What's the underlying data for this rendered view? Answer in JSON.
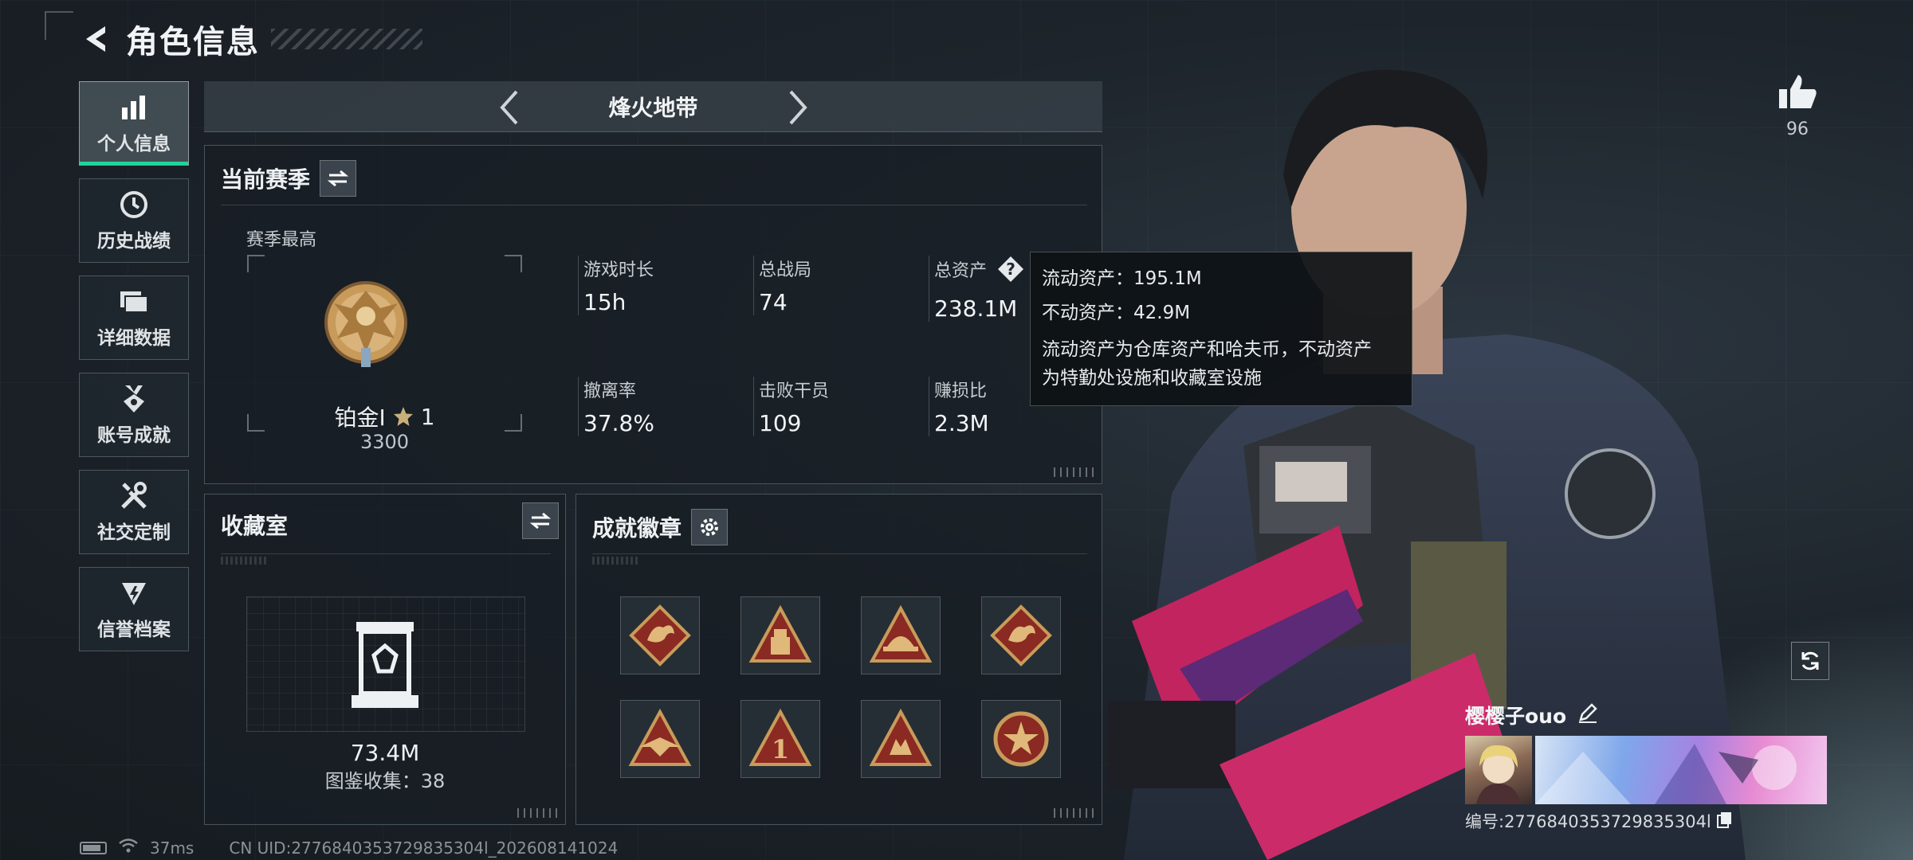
{
  "header": {
    "title": "角色信息"
  },
  "sidebar": {
    "items": [
      {
        "label": "个人信息",
        "icon": "bar-chart-icon",
        "active": true
      },
      {
        "label": "历史战绩",
        "icon": "clock-icon",
        "active": false
      },
      {
        "label": "详细数据",
        "icon": "folder-icon",
        "active": false
      },
      {
        "label": "账号成就",
        "icon": "medal-icon",
        "active": false
      },
      {
        "label": "社交定制",
        "icon": "wrench-icon",
        "active": false
      },
      {
        "label": "信誉档案",
        "icon": "shield-icon",
        "active": false
      }
    ]
  },
  "mode": {
    "title": "烽火地带"
  },
  "season": {
    "title": "当前赛季",
    "best_label": "赛季最高",
    "rank": {
      "name": "铂金Ⅰ",
      "stars": "1",
      "score": "3300"
    },
    "stats": [
      {
        "label": "游戏时长",
        "value": "15h"
      },
      {
        "label": "总战局",
        "value": "74"
      },
      {
        "label": "总资产",
        "value": "238.1M"
      },
      {
        "label": "撤离率",
        "value": "37.8%"
      },
      {
        "label": "击败干员",
        "value": "109"
      },
      {
        "label": "赚损比",
        "value": "2.3M"
      }
    ]
  },
  "tooltip": {
    "liquid": "流动资产：195.1M",
    "fixed": "不动资产：42.9M",
    "desc_line1": "流动资产为仓库资产和哈夫币，不动资产",
    "desc_line2": "为特勤处设施和收藏室设施"
  },
  "collection": {
    "title": "收藏室",
    "value": "73.4M",
    "count": "图鉴收集：38"
  },
  "achievements": {
    "title": "成就徽章",
    "badges": [
      "dragon-badge-icon",
      "tent-badge-icon",
      "helmet-badge-icon",
      "dragon-badge-icon",
      "eagle-badge-icon",
      "number-one-badge-icon",
      "hands-badge-icon",
      "star-seal-badge-icon"
    ]
  },
  "profile": {
    "likes": "96",
    "name": "樱樱子ouo",
    "uid": "编号:2776840353729835304l"
  },
  "footer": {
    "ping": "37ms",
    "uid": "CN UID:2776840353729835304l_202608141024"
  },
  "colors": {
    "accent": "#1ed49a",
    "gold": "#c89b5a",
    "badge_red": "#8a2a22"
  }
}
